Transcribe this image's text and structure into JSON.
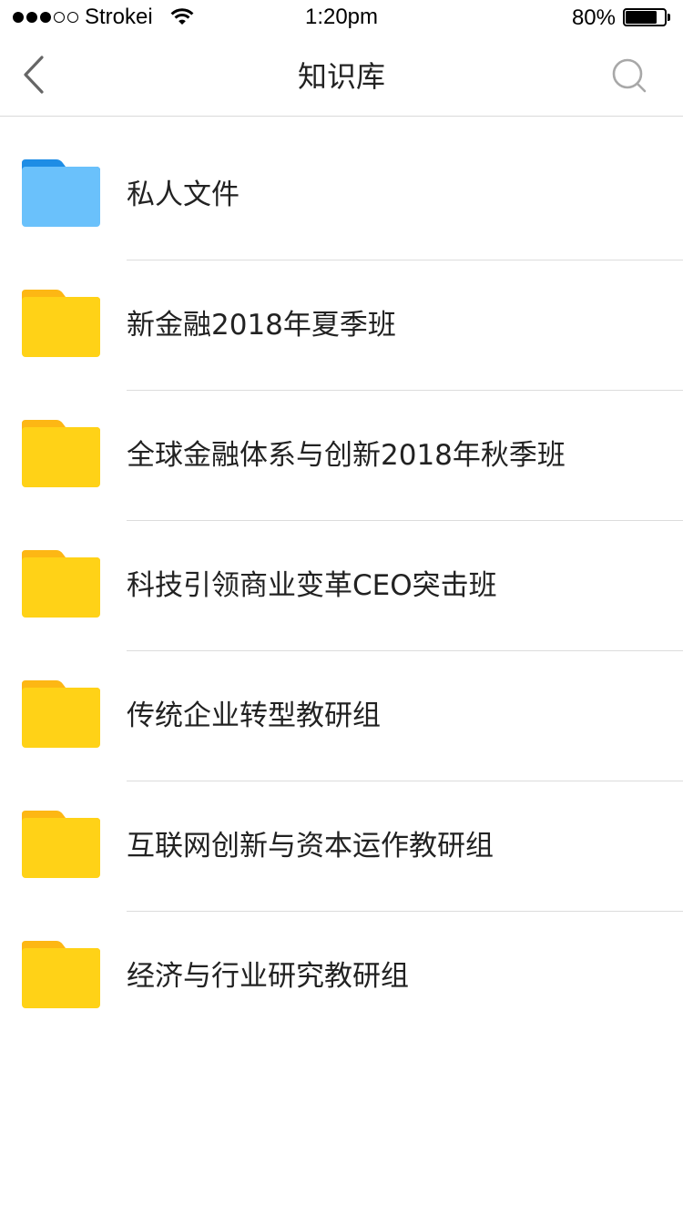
{
  "status_bar": {
    "signal_filled": 3,
    "signal_total": 5,
    "carrier": "Strokei",
    "time": "1:20pm",
    "battery_percent": "80%",
    "battery_level": 0.8
  },
  "nav": {
    "title": "知识库",
    "back_icon": "chevron-left-icon",
    "search_icon": "search-icon"
  },
  "colors": {
    "private_folder_front": "#6AC1FB",
    "private_folder_tab": "#1E8DE5",
    "shared_folder_front": "#FFD217",
    "shared_folder_tab": "#FDB714",
    "divider": "#DCDCDC"
  },
  "folders": [
    {
      "label": "私人文件",
      "kind": "private",
      "icon": "folder-icon"
    },
    {
      "label": "新金融2018年夏季班",
      "kind": "shared",
      "icon": "folder-icon"
    },
    {
      "label": "全球金融体系与创新2018年秋季班",
      "kind": "shared",
      "icon": "folder-icon"
    },
    {
      "label": "科技引领商业变革CEO突击班",
      "kind": "shared",
      "icon": "folder-icon"
    },
    {
      "label": "传统企业转型教研组",
      "kind": "shared",
      "icon": "folder-icon"
    },
    {
      "label": "互联网创新与资本运作教研组",
      "kind": "shared",
      "icon": "folder-icon"
    },
    {
      "label": "经济与行业研究教研组",
      "kind": "shared",
      "icon": "folder-icon"
    }
  ]
}
